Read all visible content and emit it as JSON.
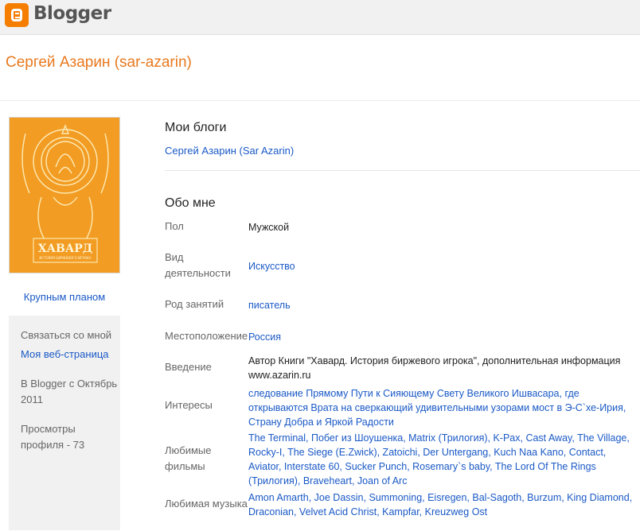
{
  "header": {
    "brand": "Blogger"
  },
  "profile": {
    "title": "Сергей Азарин (sar-azarin)",
    "cover_title": "ХАВАРД",
    "cover_subtitle": "ИСТОРИЯ БИРЖЕВОГО ИГРОКА",
    "zoom_link": "Крупным планом"
  },
  "sidebar": {
    "contact": "Связаться со мной",
    "website": "Моя веб-страница",
    "member_since": "В Blogger с Октябрь 2011",
    "views": "Просмотры профиля - 73"
  },
  "blogs": {
    "heading": "Мои блоги",
    "items": [
      "Сергей Азарин (Sar Azarin)"
    ]
  },
  "about": {
    "heading": "Обо мне",
    "rows": [
      {
        "label": "Пол",
        "value": "Мужской"
      },
      {
        "label": "Вид деятельности",
        "value": "Искусство"
      },
      {
        "label": "Род занятий",
        "value": "писатель"
      },
      {
        "label": "Местоположение",
        "value": "Россия"
      },
      {
        "label": "Введение",
        "value": "Автор Книги \"Хавард. История биржевого игрока\", дополнительная информация www.azarin.ru"
      },
      {
        "label": "Интересы",
        "value": "следование Прямому Пути к Сияющему Свету Великого Ишвасара, где открываются Врата на сверкающий удивительными узорами мост в Э-С`хе-Ирия, Страну Добра и Яркой Радости"
      },
      {
        "label": "Любимые фильмы",
        "value": "The Terminal, Побег из Шоушенка, Matrix (Трилогия), K-Pax, Cast Away, The Village, Rocky-I, The Siege (E.Zwick), Zatoichi, Der Untergang, Kuch Naa Kano, Contact, Aviator, Interstate 60, Sucker Punch, Rosemary`s baby, The Lord Of The Rings (Трилогия), Braveheart, Joan of Arc"
      },
      {
        "label": "Любимая музыка",
        "value": "Amon Amarth, Joe Dassin, Summoning, Eisregen, Bal-Sagoth, Burzum, King Diamond, Draconian, Velvet Acid Christ, Kampfar, Kreuzweg Ost"
      }
    ]
  },
  "colors": {
    "brand_orange": "#f57d00",
    "title_orange": "#e8791e",
    "link_blue": "#1a59c6"
  }
}
